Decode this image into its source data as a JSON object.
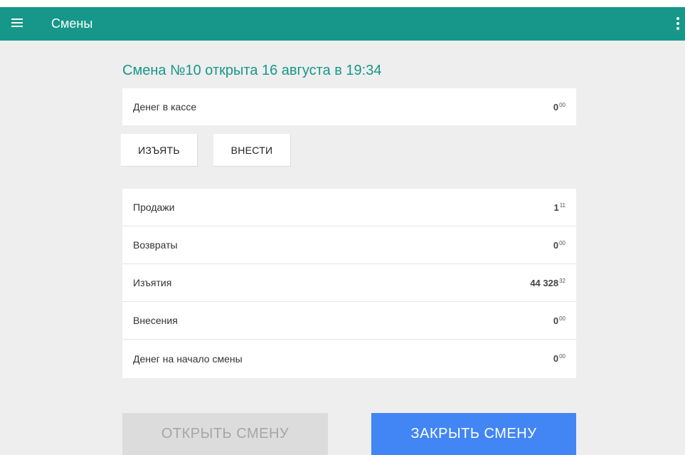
{
  "appbar": {
    "title": "Смены",
    "menu_icon": "menu-icon",
    "more_icon": "more-vert-icon",
    "color": "#16978a"
  },
  "shift": {
    "title": "Смена №10 открыта 16 августа в 19:34"
  },
  "cash": {
    "label": "Денег в кассе",
    "int": "0",
    "frac": "00"
  },
  "actions": {
    "withdraw_label": "ИЗЪЯТЬ",
    "deposit_label": "ВНЕСТИ"
  },
  "stats": [
    {
      "label": "Продажи",
      "int": "1",
      "frac": "11"
    },
    {
      "label": "Возвраты",
      "int": "0",
      "frac": "00"
    },
    {
      "label": "Изъятия",
      "int": "44 328",
      "frac": "32"
    },
    {
      "label": "Внесения",
      "int": "0",
      "frac": "00"
    },
    {
      "label": "Денег на начало смены",
      "int": "0",
      "frac": "00"
    }
  ],
  "footer": {
    "open_label": "ОТКРЫТЬ СМЕНУ",
    "close_label": "ЗАКРЫТЬ СМЕНУ",
    "close_color": "#4286f5",
    "open_disabled": true
  }
}
